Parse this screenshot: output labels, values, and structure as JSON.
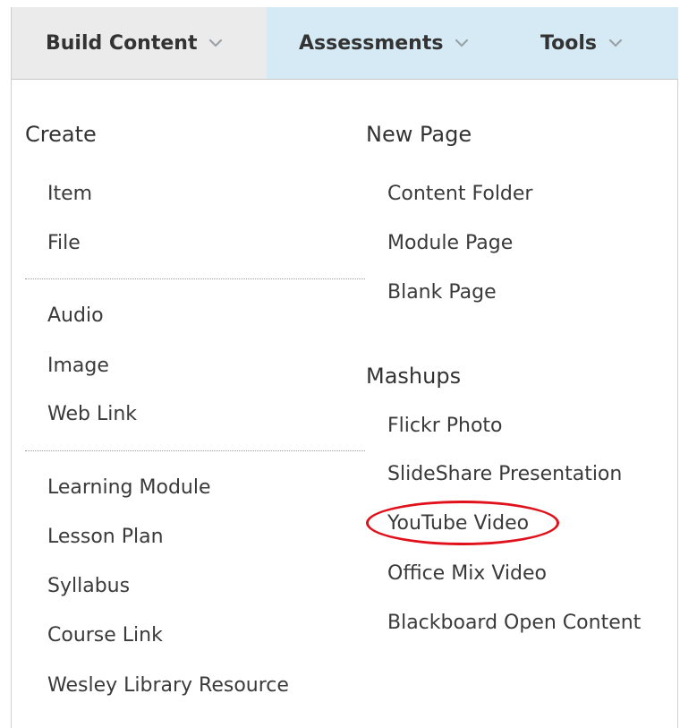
{
  "tabs": [
    {
      "label": "Build Content"
    },
    {
      "label": "Assessments"
    },
    {
      "label": "Tools"
    }
  ],
  "left_column": {
    "heading": "Create",
    "group1": [
      "Item",
      "File"
    ],
    "group2": [
      "Audio",
      "Image",
      "Web Link"
    ],
    "group3": [
      "Learning Module",
      "Lesson Plan",
      "Syllabus",
      "Course Link",
      "Wesley Library Resource"
    ]
  },
  "right_column": {
    "new_page_heading": "New Page",
    "new_page_items": [
      "Content Folder",
      "Module Page",
      "Blank Page"
    ],
    "mashups_heading": "Mashups",
    "mashups_items": [
      "Flickr Photo",
      "SlideShare Presentation",
      "YouTube Video",
      "Office Mix Video",
      "Blackboard Open Content"
    ]
  },
  "highlight": {
    "target": "YouTube Video",
    "color": "#e0111b"
  },
  "colors": {
    "build_tab_bg": "#ebebeb",
    "other_tabs_bg": "#d6eaf5",
    "text": "#333333"
  },
  "icons": {
    "tab_dropdown": "chevron-down-icon"
  }
}
